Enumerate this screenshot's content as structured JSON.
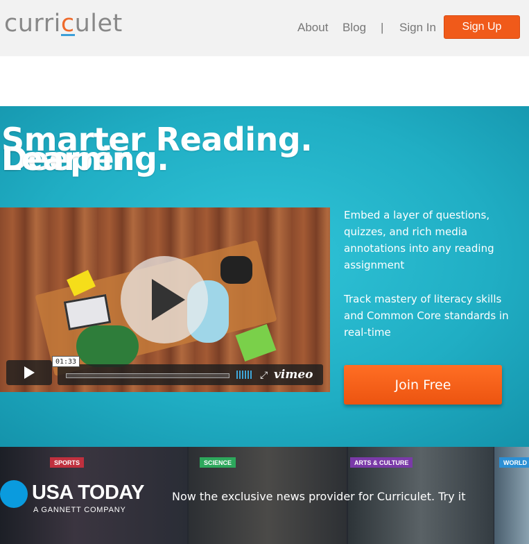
{
  "header": {
    "logo_pre": "curri",
    "logo_accent": "c",
    "logo_post": "ulet",
    "nav": {
      "about": "About",
      "blog": "Blog",
      "separator": "|",
      "sign_in": "Sign In",
      "sign_up": "Sign Up"
    }
  },
  "hero": {
    "title_line1": "Smarter Reading. Deeper",
    "title_line2": "Learning.",
    "video": {
      "time": "01:33",
      "brand": "vimeo",
      "icons": [
        "play-icon",
        "volume-icon",
        "fullscreen-icon"
      ]
    },
    "bullets": [
      "Embed a layer of questions, quizzes, and rich media annotations into any reading assignment",
      "Track mastery of literacy skills and Common Core standards in real-time"
    ],
    "cta": "Join Free"
  },
  "banner": {
    "categories": [
      "SPORTS",
      "SCIENCE",
      "ARTS & CULTURE",
      "WORLD"
    ],
    "brand": "USA TODAY",
    "brand_sub": "A GANNETT COMPANY",
    "message": "Now the exclusive news provider for Curriculet. Try it"
  },
  "colors": {
    "accent_orange": "#f05a1a",
    "hero_teal": "#20aec4",
    "usa_blue": "#0a9bde"
  }
}
